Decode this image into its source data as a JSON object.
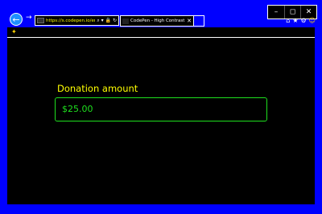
{
  "window": {
    "controls": [
      "–",
      "◻",
      "✕"
    ]
  },
  "nav": {
    "back_icon": "back-arrow-icon",
    "back_glyph": "←",
    "forward_glyph": "→"
  },
  "address_bar": {
    "url": "https://s.codepen.io/eric",
    "icons": "⌕ ▾ 🔒 ↻"
  },
  "tabs": [
    {
      "title": "CodePen - High Contrast ...",
      "close": "✕"
    }
  ],
  "toolbar": {
    "home": "⌂",
    "favorites": "★",
    "settings": "⚙",
    "feedback": "☺"
  },
  "favorites_bar": {
    "add_icon": "✦"
  },
  "form": {
    "label": "Donation amount",
    "amount_value": "$25.00"
  },
  "colors": {
    "frame": "#0000ff",
    "label": "#ffff00",
    "input_accent": "#1ee01e"
  }
}
